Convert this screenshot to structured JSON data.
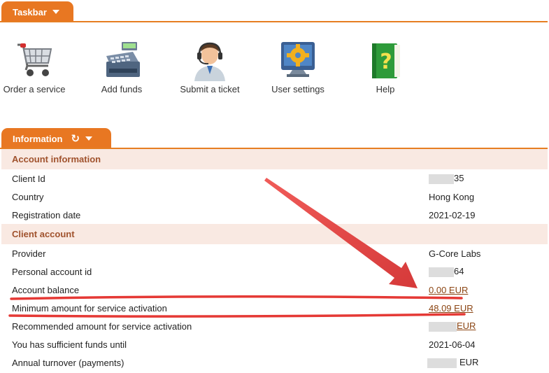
{
  "taskbar": {
    "tab_label": "Taskbar",
    "items": [
      {
        "label": "Order a service",
        "icon": "shopping-cart-icon"
      },
      {
        "label": "Add funds",
        "icon": "cash-register-icon"
      },
      {
        "label": "Submit a ticket",
        "icon": "support-agent-icon"
      },
      {
        "label": "User settings",
        "icon": "settings-monitor-icon"
      },
      {
        "label": "Help",
        "icon": "help-book-icon"
      }
    ]
  },
  "information": {
    "tab_label": "Information",
    "sections": [
      {
        "title": "Account information",
        "rows": [
          {
            "label": "Client Id",
            "value": "35"
          },
          {
            "label": "Country",
            "value": "Hong Kong"
          },
          {
            "label": "Registration date",
            "value": "2021-02-19"
          }
        ]
      },
      {
        "title": "Client account",
        "rows": [
          {
            "label": "Provider",
            "value": "G-Core Labs"
          },
          {
            "label": "Personal account id",
            "value": "64"
          },
          {
            "label": "Account balance",
            "value": "0.00 EUR"
          },
          {
            "label": "Minimum amount for service activation",
            "value": "48.09 EUR"
          },
          {
            "label": "Recommended amount for service activation",
            "value": "EUR"
          },
          {
            "label": "You has sufficient funds until",
            "value": "2021-06-04"
          },
          {
            "label": "Annual turnover (payments)",
            "value": "EUR"
          }
        ]
      }
    ]
  },
  "colors": {
    "accent": "#e87722",
    "section_bg": "#f9e9e2",
    "section_text": "#a0522d",
    "link": "#8b4513",
    "annotation": "#e53935"
  }
}
